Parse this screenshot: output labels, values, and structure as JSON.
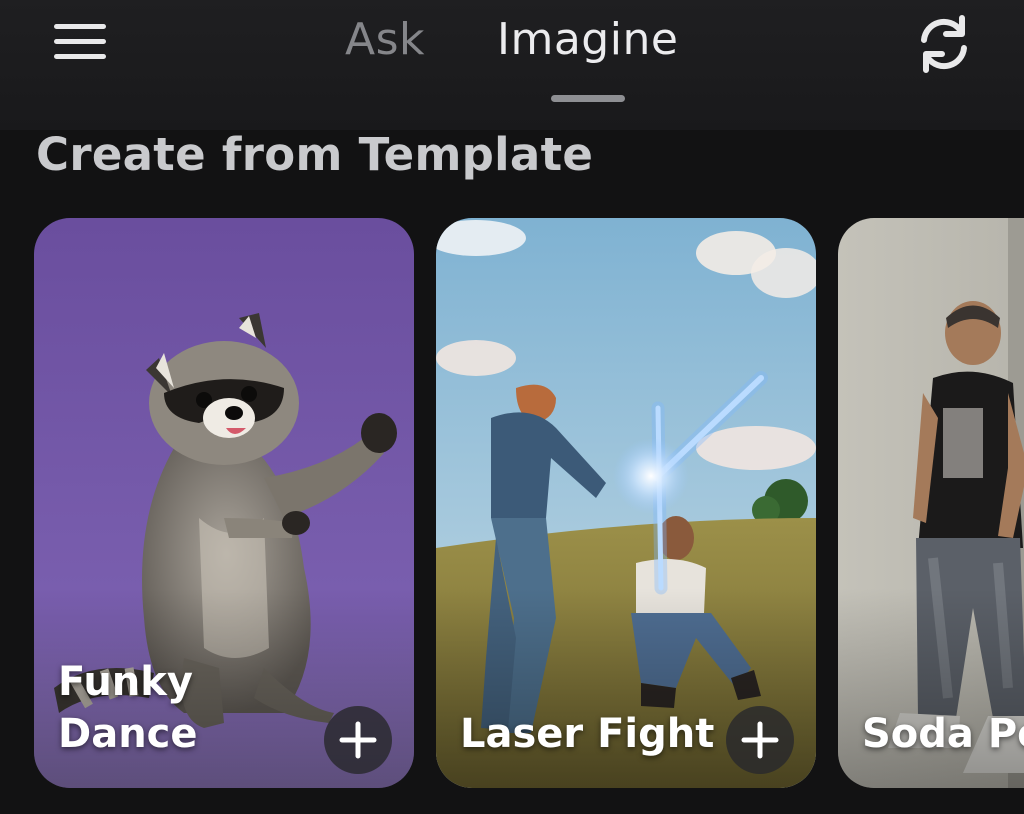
{
  "header": {
    "tabs": [
      {
        "label": "Ask",
        "active": false
      },
      {
        "label": "Imagine",
        "active": true
      }
    ],
    "menu_icon": "hamburger-menu-icon",
    "refresh_icon": "refresh-icon"
  },
  "section": {
    "title": "Create from Template"
  },
  "templates": [
    {
      "label_line1": "Funky",
      "label_line2": "Dance",
      "image": "raccoon dancing on purple background",
      "action_icon": "plus-icon"
    },
    {
      "label_line1": "Laser Fight",
      "image": "two people with lightsabers in a field",
      "action_icon": "plus-icon"
    },
    {
      "label_line1": "Soda Po",
      "image": "person leaning against wall",
      "action_icon": "plus-icon"
    }
  ],
  "colors": {
    "background": "#121213",
    "active_tab": "#ececee",
    "inactive_tab": "#85868a",
    "title": "#c9cacd"
  }
}
